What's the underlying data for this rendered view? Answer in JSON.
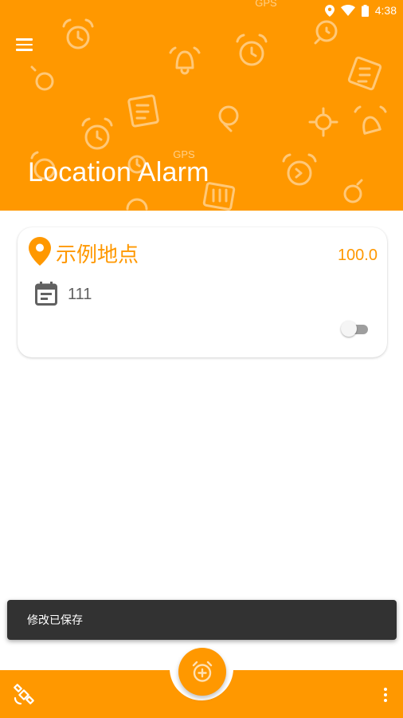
{
  "status_bar": {
    "time": "4:38",
    "icons": [
      "location-pin-icon",
      "wifi-icon",
      "battery-icon"
    ]
  },
  "header": {
    "title": "Location Alarm",
    "background_color": "#FF9800",
    "menu_icon": "hamburger-menu-icon",
    "pattern_texts": [
      "GPS",
      "GPS"
    ]
  },
  "card": {
    "location_name": "示例地点",
    "radius_value": "100.0",
    "note": "111",
    "enabled": false,
    "icons": [
      "location-pin-icon",
      "calendar-icon"
    ]
  },
  "snackbar": {
    "message": "修改已保存"
  },
  "bottom_bar": {
    "fab_icon": "add-alarm-icon",
    "left_icon": "satellite-icon",
    "right_icon": "more-vertical-icon"
  },
  "colors": {
    "accent": "#FF9800",
    "snackbar": "#323232",
    "text_secondary": "#616161"
  }
}
